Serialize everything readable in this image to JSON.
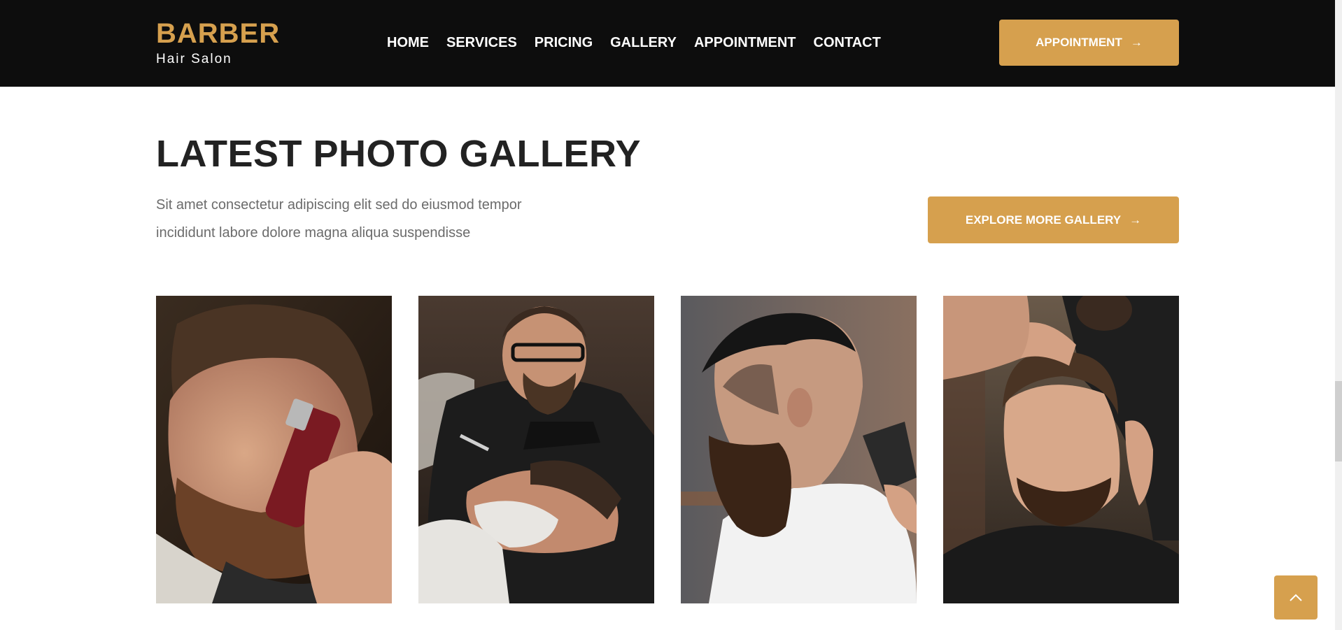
{
  "header": {
    "logo_title": "BARBER",
    "logo_subtitle": "Hair Salon",
    "nav": [
      "HOME",
      "SERVICES",
      "PRICING",
      "GALLERY",
      "APPOINTMENT",
      "CONTACT"
    ],
    "appointment_button": "APPOINTMENT",
    "background_color": "#0d0d0d"
  },
  "gallery_section": {
    "title": "LATEST PHOTO GALLERY",
    "description_line1": "Sit amet consectetur adipiscing elit sed do eiusmod tempor",
    "description_line2": "incididunt labore dolore magna aliqua suspendisse",
    "explore_button": "EXPLORE MORE GALLERY"
  },
  "photos": [
    {
      "subject": "man beard trimmed with clipper"
    },
    {
      "subject": "barber shaving reclined client"
    },
    {
      "subject": "bearded man side profile fade haircut"
    },
    {
      "subject": "barber styling client's hair"
    }
  ],
  "colors": {
    "accent": "#d6a04e",
    "heading": "#222222",
    "body_text": "#6b6b6b"
  },
  "icons": {
    "button_arrow": "arrow-right-icon",
    "back_to_top": "chevron-up-icon"
  }
}
